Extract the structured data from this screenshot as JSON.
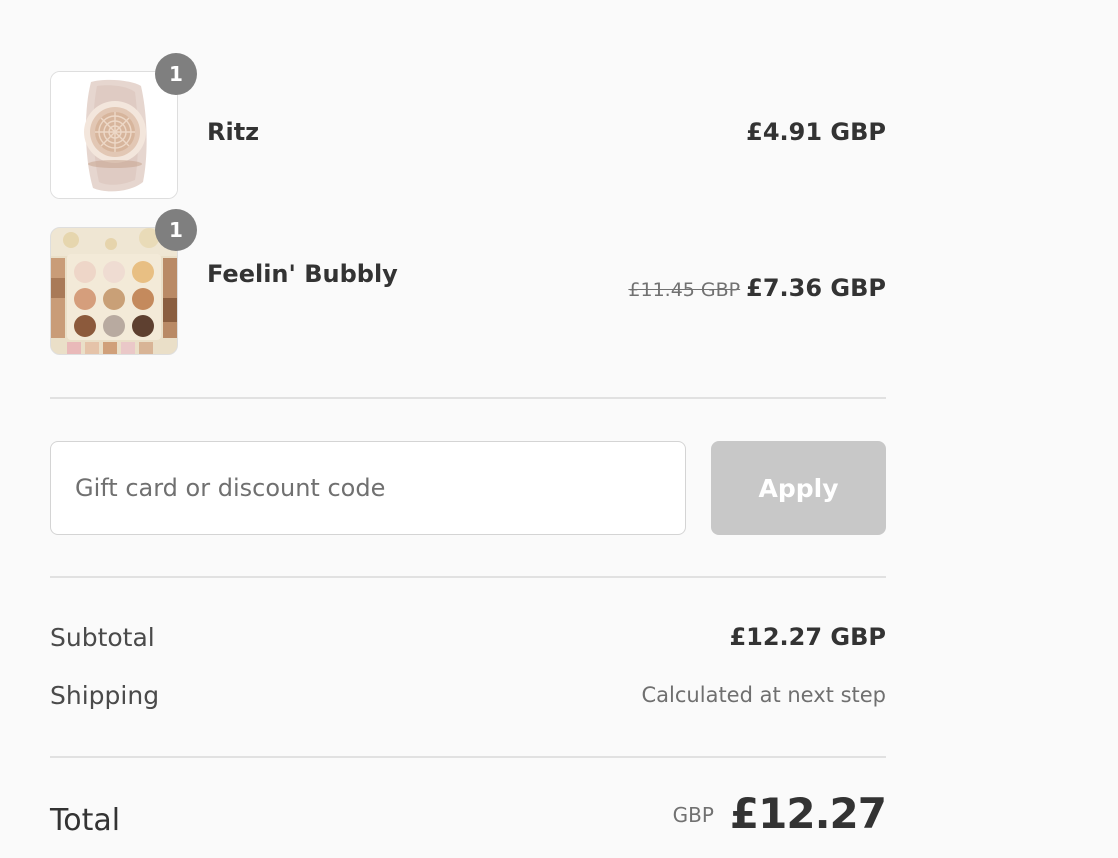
{
  "line_items": [
    {
      "name": "Ritz",
      "quantity": "1",
      "original_price": "",
      "price": "£4.91 GBP",
      "image_icon": "highlighter-compact-thumbnail"
    },
    {
      "name": "Feelin' Bubbly",
      "quantity": "1",
      "original_price": "£11.45 GBP",
      "price": "£7.36 GBP",
      "image_icon": "eyeshadow-palette-thumbnail"
    }
  ],
  "discount": {
    "placeholder": "Gift card or discount code",
    "value": "",
    "apply_label": "Apply"
  },
  "totals": {
    "subtotal_label": "Subtotal",
    "subtotal_value": "£12.27 GBP",
    "shipping_label": "Shipping",
    "shipping_value": "Calculated at next step",
    "total_label": "Total",
    "total_currency": "GBP",
    "total_amount": "£12.27"
  },
  "colors": {
    "background": "#fafafa",
    "badge": "#7f7f7f",
    "apply_button_disabled": "#c8c8c8",
    "divider": "#e1e1e1",
    "text_primary": "#333333"
  }
}
